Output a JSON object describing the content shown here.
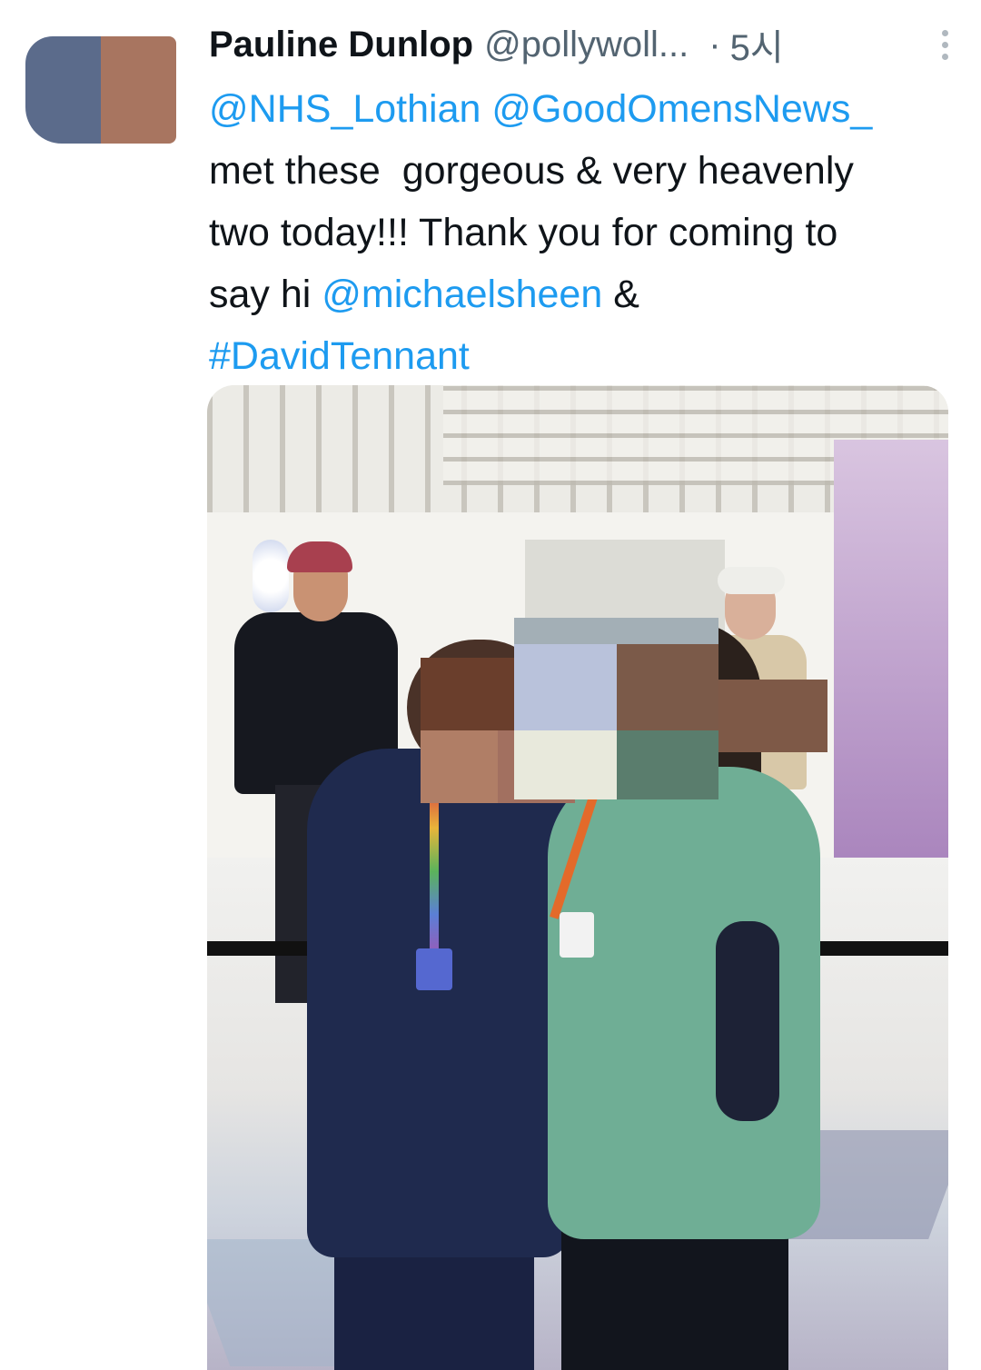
{
  "tweet": {
    "author_name": "Pauline Dunlop",
    "author_handle": "@pollywoll...",
    "separator": "·",
    "timestamp": "5시",
    "text_lines": [
      [
        {
          "t": "@NHS_Lothian",
          "link": true
        },
        {
          "t": " ",
          "link": false
        },
        {
          "t": "@GoodOmensNews_",
          "link": true
        }
      ],
      [
        {
          "t": "met these  gorgeous & very heavenly",
          "link": false
        }
      ],
      [
        {
          "t": "two today!!! Thank you for coming to",
          "link": false
        }
      ],
      [
        {
          "t": "say hi ",
          "link": false
        },
        {
          "t": "@michaelsheen",
          "link": true
        },
        {
          "t": " &",
          "link": false
        }
      ],
      [
        {
          "t": "#DavidTennant",
          "link": true
        }
      ]
    ]
  },
  "icons": {
    "more": "more-vertical-icon"
  },
  "colors": {
    "link": "#1d9bf0",
    "text": "#0f1419",
    "secondary": "#536471"
  }
}
